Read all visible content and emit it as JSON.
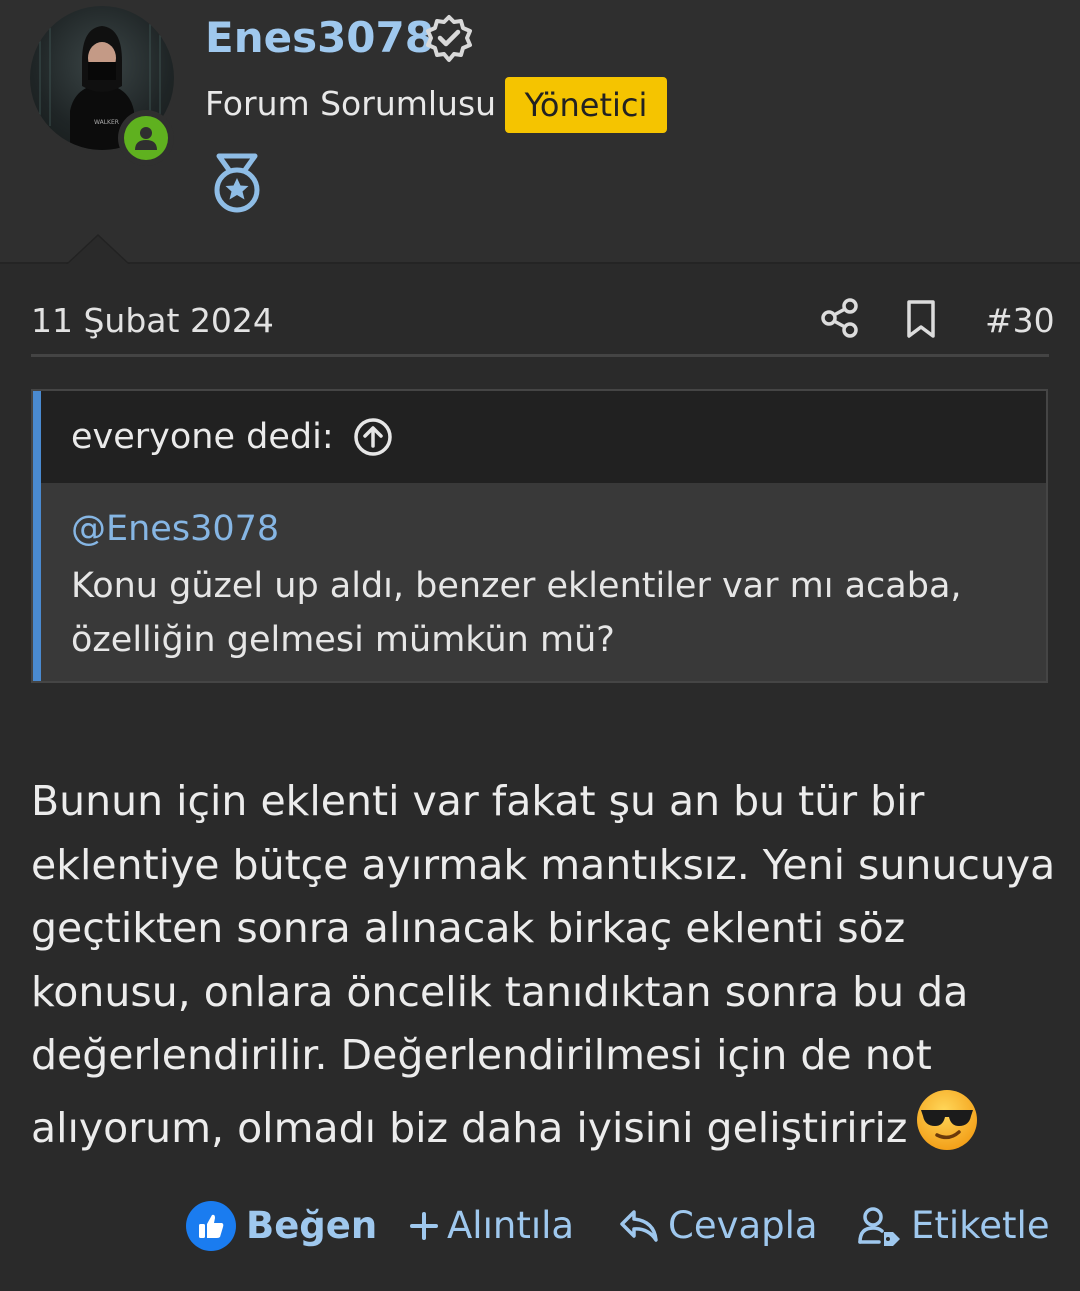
{
  "user": {
    "username": "Enes3078",
    "title": "Forum Sorumlusu",
    "role_badge": "Yönetici",
    "role_badge_color": "#f5c400",
    "username_color": "#9fc8ee",
    "online_status_color": "#5fb11f",
    "icons": [
      "verified-badge-icon",
      "medal-icon",
      "online-user-icon"
    ]
  },
  "post": {
    "date": "11 Şubat 2024",
    "number": "#30",
    "header_icons": [
      "share-icon",
      "bookmark-icon"
    ]
  },
  "quote": {
    "author": "everyone dedi:",
    "mention": "@Enes3078",
    "text": "Konu güzel up aldı, benzer eklentiler var mı acaba, özelliğin gelmesi mümkün mü?",
    "accent_color": "#4a8ad0"
  },
  "message": {
    "text": "Bunun için eklenti var fakat şu an bu tür bir eklentiye bütçe ayırmak mantıksız. Yeni sunucuya geçtikten sonra alınacak birkaç eklenti söz konusu, onlara öncelik tanıdıktan sonra bu da değerlendirilir. Değerlendirilmesi için de not alıyorum, olmadı biz daha iyisini geliştiririz",
    "emoji": "sunglasses-emoji"
  },
  "actions": {
    "like": "Beğen",
    "quote": "Alıntıla",
    "reply": "Cevapla",
    "tag": "Etiketle",
    "link_color": "#9fc8ee",
    "like_icon_color": "#1a7cf0"
  }
}
